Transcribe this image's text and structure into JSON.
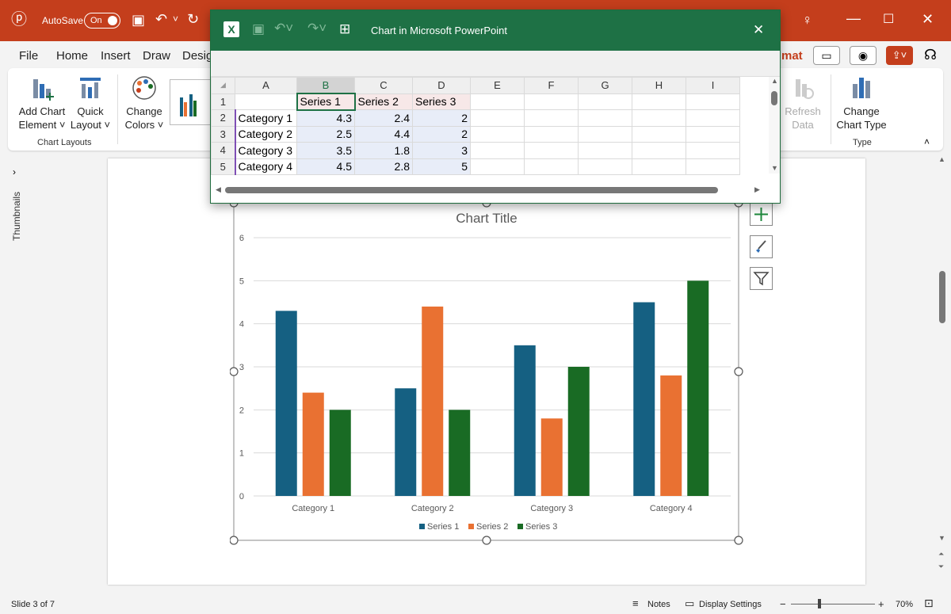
{
  "titlebar": {
    "autosave_label": "AutoSave",
    "autosave_state": "On"
  },
  "menu": {
    "tabs": [
      "File",
      "Home",
      "Insert",
      "Draw",
      "Desig"
    ],
    "format_tab": "mat"
  },
  "ribbon": {
    "add_chart_element": [
      "Add Chart",
      "Element ˅"
    ],
    "quick_layout": [
      "Quick",
      "Layout ˅"
    ],
    "change_colors": [
      "Change",
      "Colors ˅"
    ],
    "chart_layouts_group": "Chart Layouts",
    "refresh_data": [
      "Refresh",
      "Data"
    ],
    "change_chart_type": [
      "Change",
      "Chart Type"
    ],
    "type_group": "Type"
  },
  "side": {
    "thumbnails_label": "Thumbnails"
  },
  "excel": {
    "title": "Chart in Microsoft PowerPoint",
    "columns": [
      "A",
      "B",
      "C",
      "D",
      "E",
      "F",
      "G",
      "H",
      "I"
    ],
    "rows": [
      [
        "1",
        "",
        "Series 1",
        "Series 2",
        "Series 3",
        "",
        "",
        "",
        "",
        ""
      ],
      [
        "2",
        "Category 1",
        "4.3",
        "2.4",
        "2",
        "",
        "",
        "",
        "",
        ""
      ],
      [
        "3",
        "Category 2",
        "2.5",
        "4.4",
        "2",
        "",
        "",
        "",
        "",
        ""
      ],
      [
        "4",
        "Category 3",
        "3.5",
        "1.8",
        "3",
        "",
        "",
        "",
        "",
        ""
      ],
      [
        "5",
        "Category 4",
        "4.5",
        "2.8",
        "5",
        "",
        "",
        "",
        "",
        ""
      ]
    ]
  },
  "chart_data": {
    "type": "bar",
    "title": "Chart Title",
    "categories": [
      "Category 1",
      "Category 2",
      "Category 3",
      "Category 4"
    ],
    "series": [
      {
        "name": "Series 1",
        "values": [
          4.3,
          2.5,
          3.5,
          4.5
        ],
        "color": "#156082"
      },
      {
        "name": "Series 2",
        "values": [
          2.4,
          4.4,
          1.8,
          2.8
        ],
        "color": "#e97132"
      },
      {
        "name": "Series 3",
        "values": [
          2,
          2,
          3,
          5
        ],
        "color": "#196b24"
      }
    ],
    "ylim": [
      0,
      6
    ],
    "yticks": [
      "0",
      "1",
      "2",
      "3",
      "4",
      "5",
      "6"
    ],
    "grid": true,
    "legend": "bottom"
  },
  "statusbar": {
    "slide_info": "Slide 3 of 7",
    "notes": "Notes",
    "display_settings": "Display Settings",
    "zoom": "70%",
    "zoom_out": "−",
    "zoom_in": "+"
  },
  "colors": {
    "powerpoint_red": "#c43e1c",
    "excel_green": "#1e7145"
  }
}
